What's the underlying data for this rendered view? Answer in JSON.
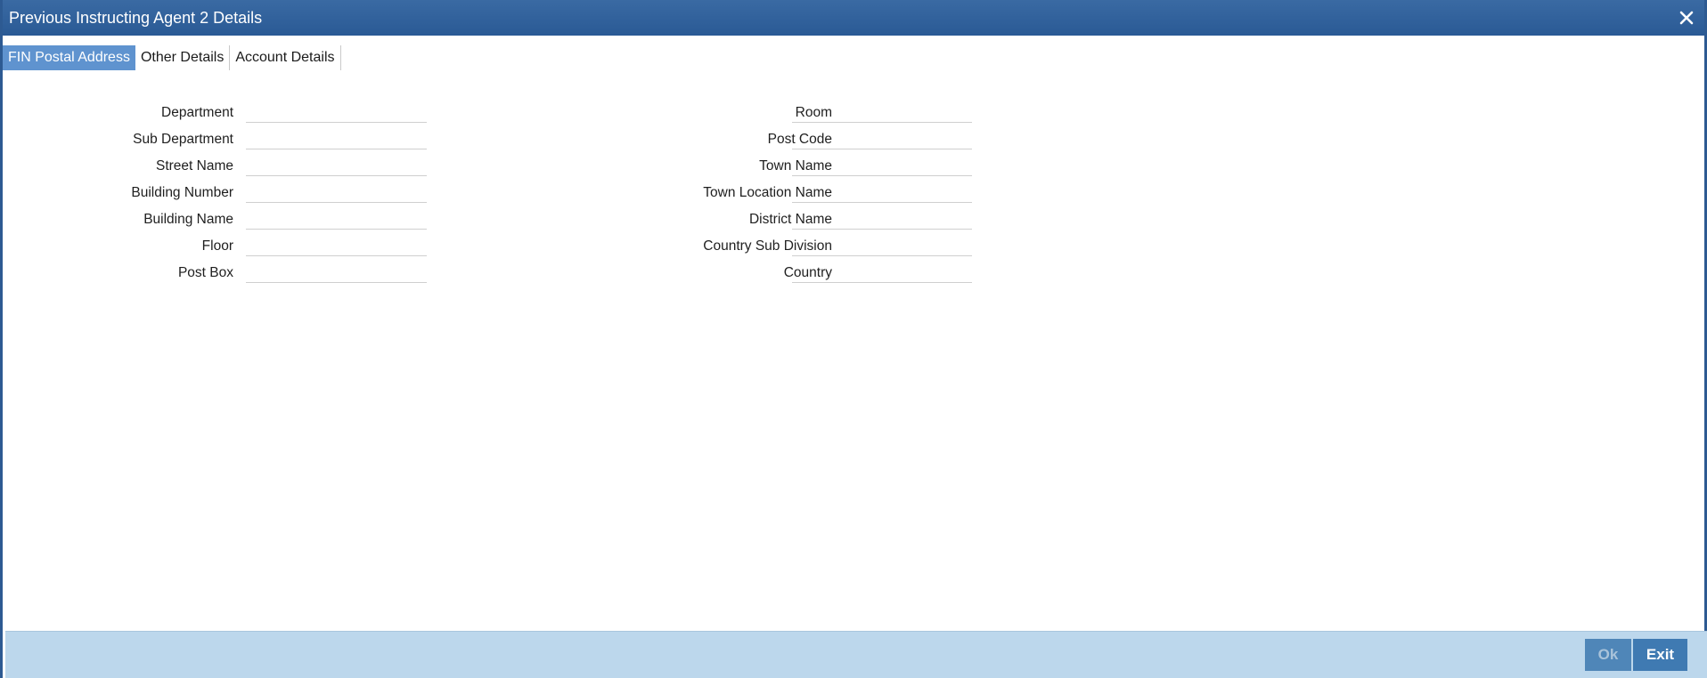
{
  "window": {
    "title": "Previous Instructing Agent 2 Details",
    "close_icon": "close-icon"
  },
  "tabs": [
    {
      "label": "FIN Postal Address",
      "active": true
    },
    {
      "label": "Other Details",
      "active": false
    },
    {
      "label": "Account Details",
      "active": false
    }
  ],
  "form": {
    "left": [
      {
        "label": "Department",
        "value": ""
      },
      {
        "label": "Sub Department",
        "value": ""
      },
      {
        "label": "Street Name",
        "value": ""
      },
      {
        "label": "Building Number",
        "value": ""
      },
      {
        "label": "Building Name",
        "value": ""
      },
      {
        "label": "Floor",
        "value": ""
      },
      {
        "label": "Post Box",
        "value": ""
      }
    ],
    "right": [
      {
        "label": "Room",
        "value": ""
      },
      {
        "label": "Post Code",
        "value": ""
      },
      {
        "label": "Town Name",
        "value": ""
      },
      {
        "label": "Town Location Name",
        "value": ""
      },
      {
        "label": "District Name",
        "value": ""
      },
      {
        "label": "Country Sub Division",
        "value": ""
      },
      {
        "label": "Country",
        "value": ""
      }
    ]
  },
  "footer": {
    "ok_label": "Ok",
    "exit_label": "Exit"
  },
  "colors": {
    "titlebar": "#2d5a92",
    "active_tab": "#5f93cf",
    "footer_bg": "#bcd7ec",
    "button": "#3f7ab2"
  }
}
